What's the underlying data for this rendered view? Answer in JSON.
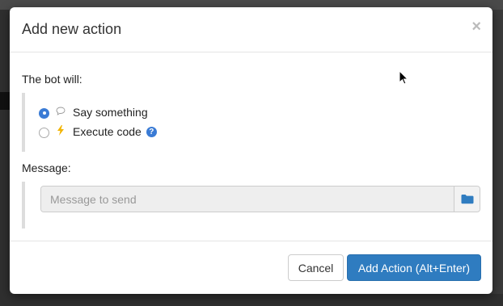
{
  "modal": {
    "title": "Add new action",
    "close_glyph": "×"
  },
  "form": {
    "bot_will_label": "The bot will:",
    "options": [
      {
        "label": "Say something",
        "icon": "speech-bubble-icon",
        "checked": true
      },
      {
        "label": "Execute code",
        "icon": "lightning-bolt-icon",
        "checked": false
      }
    ],
    "help_glyph": "?",
    "message_label": "Message:",
    "message_placeholder": "Message to send",
    "message_value": ""
  },
  "footer": {
    "cancel_label": "Cancel",
    "add_label": "Add Action (Alt+Enter)"
  },
  "colors": {
    "accent": "#2f7cc0",
    "radio_checked": "#3a7bd5",
    "bolt": "#f2b400"
  }
}
